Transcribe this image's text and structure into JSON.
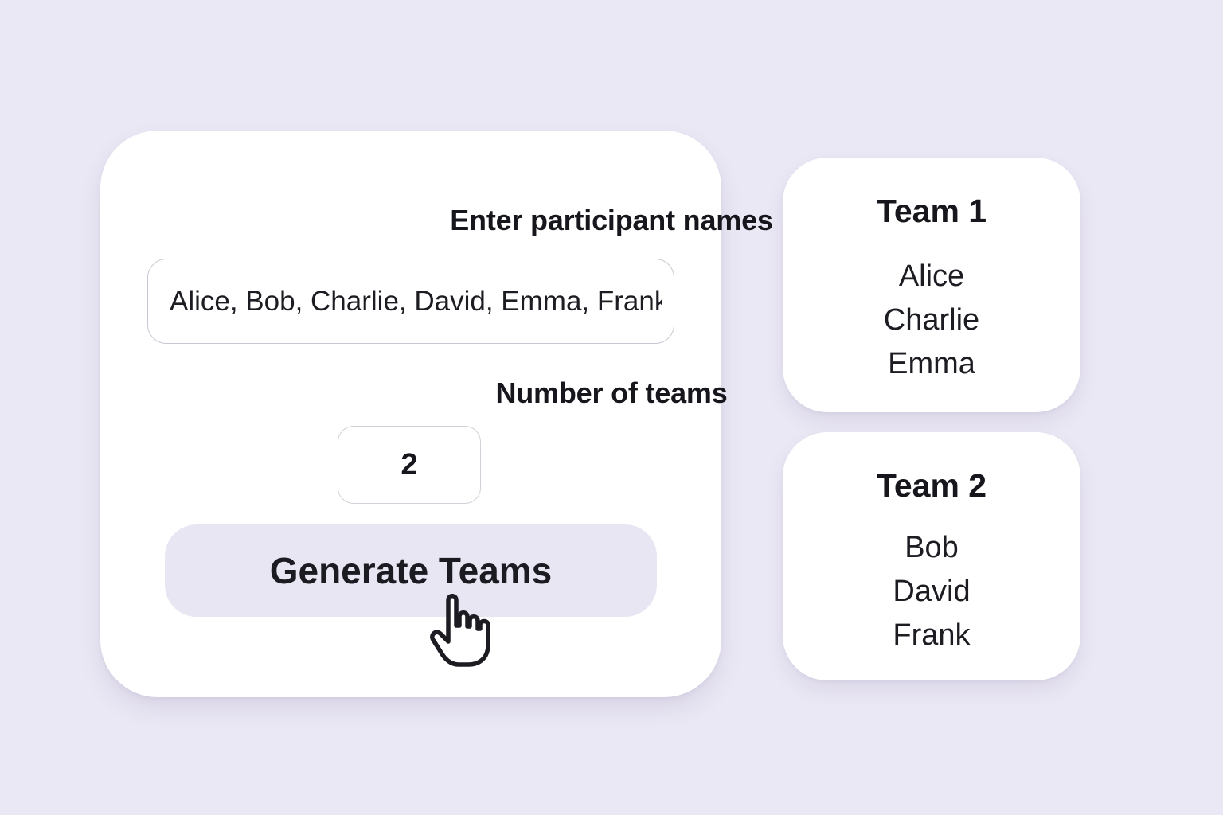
{
  "form": {
    "names_label": "Enter participant names",
    "names_value": "Alice, Bob, Charlie, David, Emma, Frank",
    "teams_label": "Number of teams",
    "teams_value": "2",
    "generate_label": "Generate Teams"
  },
  "cursor": {
    "icon": "hand-pointer-icon"
  },
  "results": {
    "teams": [
      {
        "title": "Team 1",
        "members": [
          "Alice",
          "Charlie",
          "Emma"
        ]
      },
      {
        "title": "Team 2",
        "members": [
          "Bob",
          "David",
          "Frank"
        ]
      }
    ]
  },
  "colors": {
    "background": "#ebe8f5",
    "card": "#ffffff",
    "button": "#e8e6f2",
    "text": "#16161c"
  }
}
